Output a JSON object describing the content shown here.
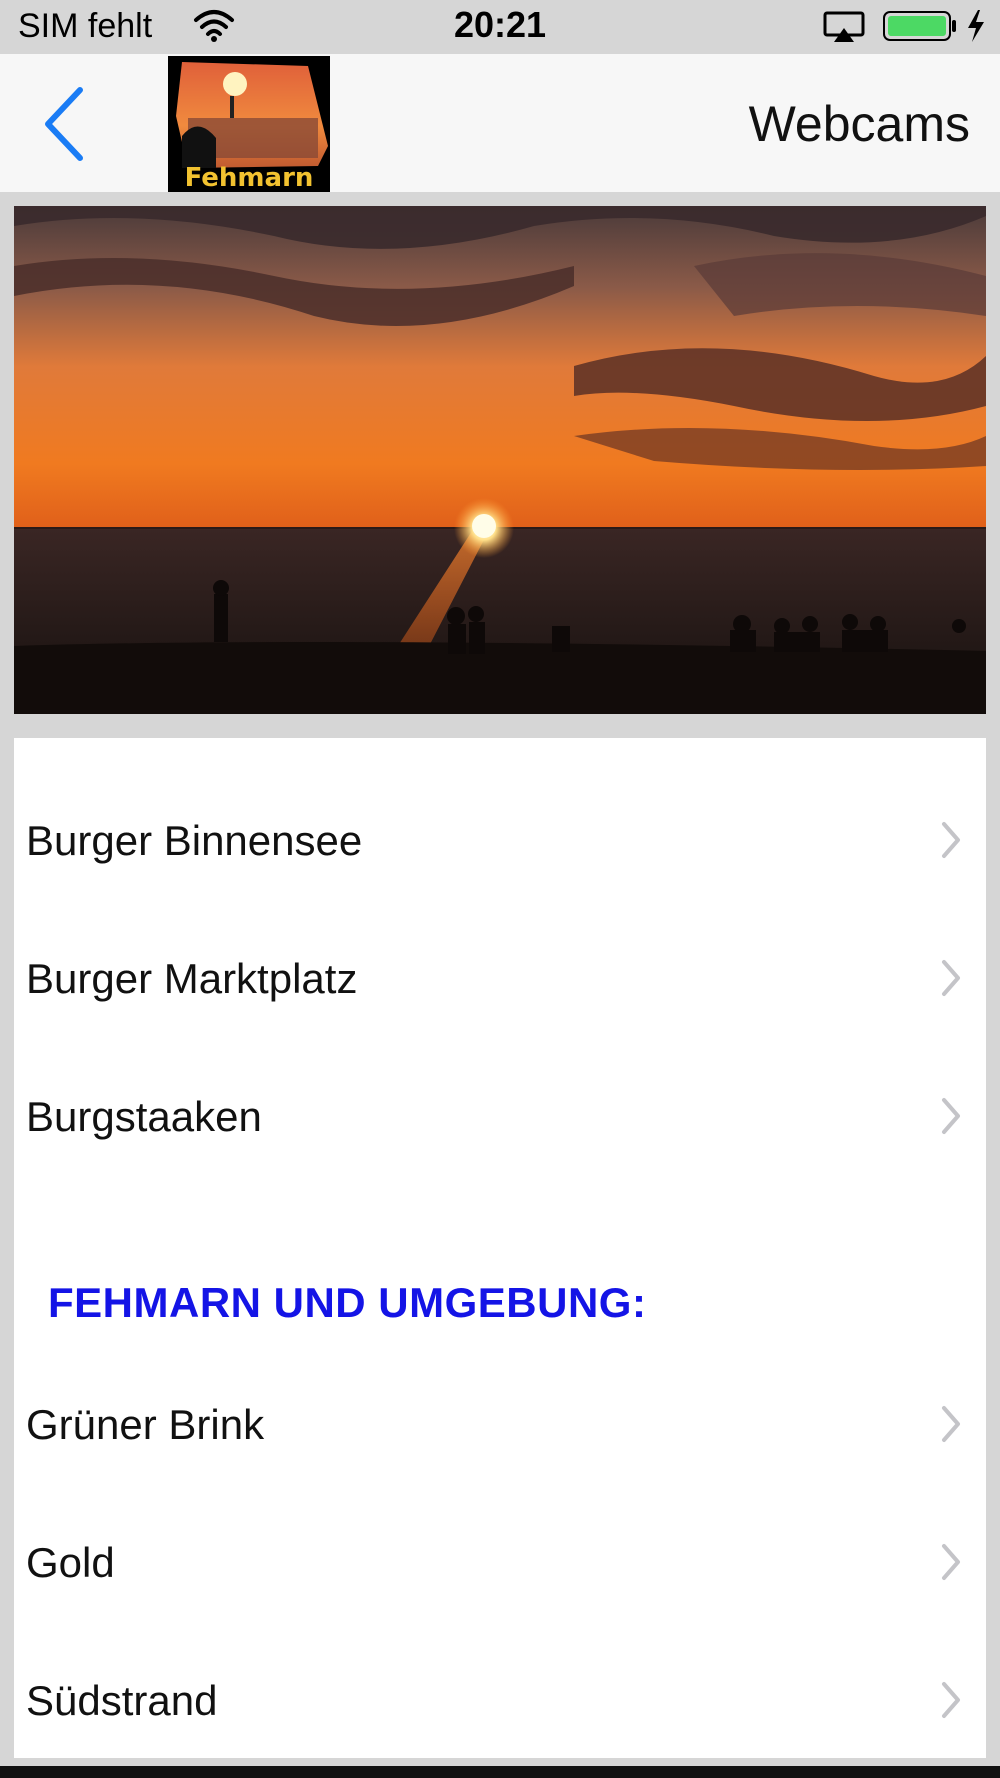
{
  "status_bar": {
    "carrier": "SIM fehlt",
    "time": "20:21",
    "battery_color": "#4cd964",
    "icons": [
      "wifi-icon",
      "airplay-icon",
      "battery-icon",
      "charging-icon"
    ]
  },
  "nav": {
    "title": "Webcams",
    "logo_text": "Fehmarn",
    "back_icon": "chevron-left-icon",
    "accent_color": "#1a7cf5"
  },
  "list": {
    "rows_group_1": [
      {
        "label": "Burger Binnensee"
      },
      {
        "label": "Burger Marktplatz"
      },
      {
        "label": "Burgstaaken"
      }
    ],
    "section_header": "FEHMARN UND UMGEBUNG:",
    "section_header_color": "#1414e6",
    "rows_group_2": [
      {
        "label": "Grüner Brink"
      },
      {
        "label": "Gold"
      },
      {
        "label": "Südstrand"
      }
    ]
  }
}
